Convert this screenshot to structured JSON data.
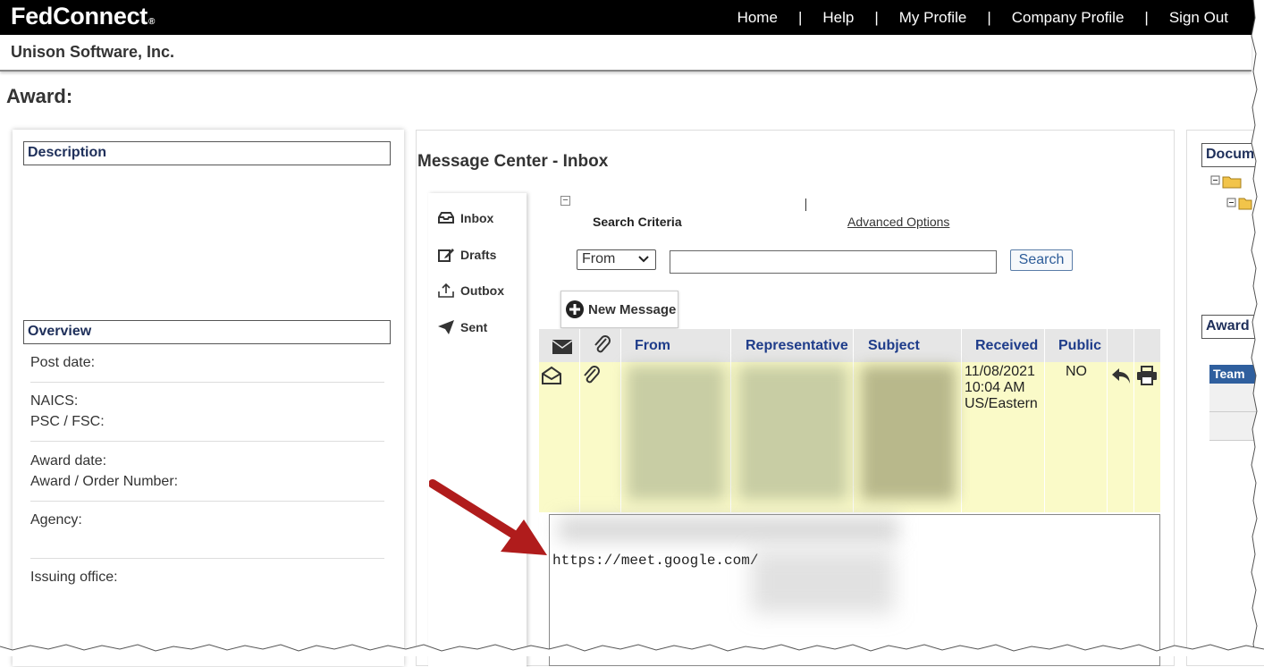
{
  "app": {
    "logo": "FedConnect",
    "logo_mark": "®"
  },
  "nav": {
    "home": "Home",
    "help": "Help",
    "my_profile": "My Profile",
    "company_profile": "Company Profile",
    "sign_out": "Sign Out",
    "separator": "|"
  },
  "company_name": "Unison Software, Inc.",
  "page_title": "Award:",
  "left": {
    "description_header": "Description",
    "overview_header": "Overview",
    "post_date": "Post date:",
    "naics": "NAICS:",
    "psc_fsc": "PSC / FSC:",
    "award_date": "Award date:",
    "award_order_number": "Award / Order Number:",
    "agency": "Agency:",
    "issuing_office": "Issuing office:"
  },
  "message_center": {
    "title": "Message Center - Inbox",
    "folders": {
      "inbox": "Inbox",
      "drafts": "Drafts",
      "outbox": "Outbox",
      "sent": "Sent"
    },
    "collapse_glyph": "⊟",
    "search_criteria": "Search Criteria",
    "advanced_options": "Advanced Options",
    "search_field": {
      "selected": "From",
      "value": ""
    },
    "search_button": "Search",
    "new_message": "New Message",
    "columns": {
      "from": "From",
      "representative": "Representative",
      "subject": "Subject",
      "received": "Received",
      "public": "Public"
    },
    "rows": [
      {
        "received_date": "11/08/2021",
        "received_time": "10:04 AM",
        "received_tz": "US/Eastern",
        "public": "NO"
      }
    ],
    "preview_url": "https://meet.google.com/"
  },
  "right": {
    "documents_header": "Docum",
    "award_header": "Award",
    "team_header": "Team"
  },
  "colors": {
    "topbar": "#000000",
    "header_text": "#1e2f5a",
    "column_text": "#1e3c8a",
    "row_highlight": "#fafac8",
    "arrow": "#b01c1c",
    "team_header": "#2f5f9e"
  },
  "icons": [
    "inbox-icon",
    "drafts-icon",
    "outbox-icon",
    "sent-icon",
    "envelope-icon",
    "paperclip-icon",
    "open-envelope-icon",
    "reply-icon",
    "print-icon",
    "plus-circle-icon",
    "chevron-down-icon",
    "folder-icon",
    "tree-collapse-icon",
    "red-arrow"
  ]
}
